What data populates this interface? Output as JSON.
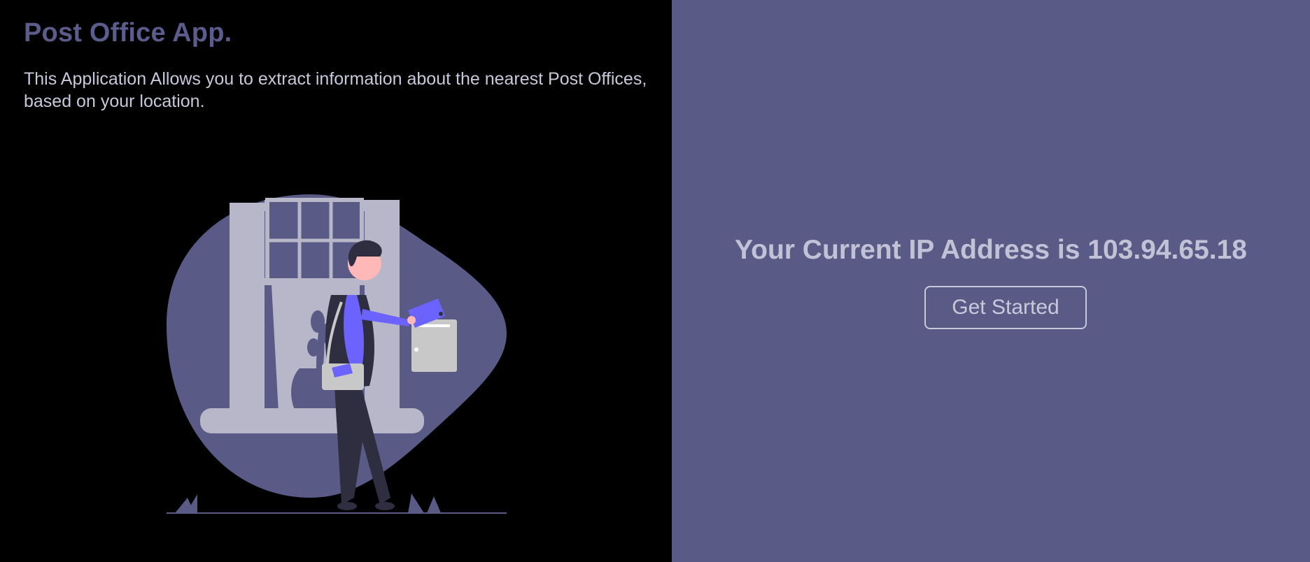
{
  "intro": {
    "title": "Post Office App.",
    "description": "This Application Allows you to extract information about the nearest Post Offices, based on your location."
  },
  "ip_panel": {
    "heading": "Your Current IP Address is 103.94.65.18",
    "button_label": "Get Started"
  },
  "colors": {
    "left_background": "#000000",
    "right_background": "#5a5a87",
    "title_color": "#5b5b8c",
    "text_color": "#c8c8dc",
    "accent_purple": "#6c63ff"
  },
  "illustration": {
    "icon": "mail-carrier-illustration"
  }
}
